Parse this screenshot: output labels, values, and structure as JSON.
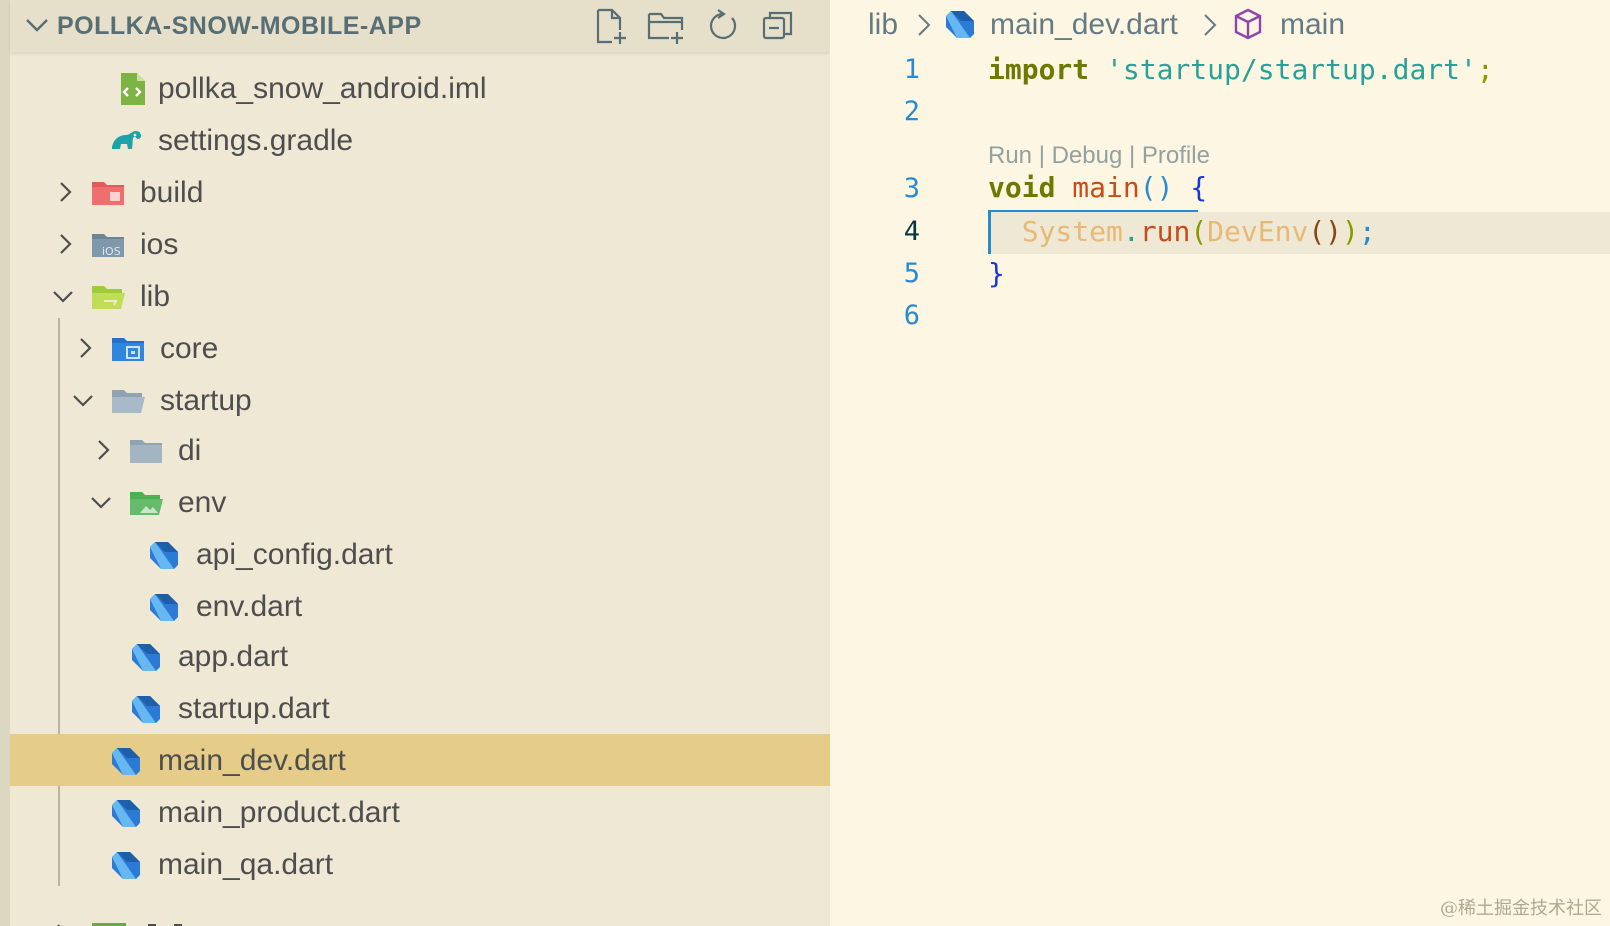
{
  "explorer": {
    "title": "POLLKA-SNOW-MOBILE-APP",
    "actions": [
      "new-file-icon",
      "new-folder-icon",
      "refresh-icon",
      "collapse-all-icon"
    ],
    "items": [
      {
        "label": "pollka_snow_android.iml",
        "icon": "xml-file-icon",
        "kind": "file",
        "depth": 2
      },
      {
        "label": "settings.gradle",
        "icon": "gradle-icon",
        "kind": "file",
        "depth": 2
      },
      {
        "label": "build",
        "icon": "build-folder-icon",
        "kind": "folder",
        "expanded": false,
        "depth": 1
      },
      {
        "label": "ios",
        "icon": "ios-folder-icon",
        "kind": "folder",
        "expanded": false,
        "depth": 1
      },
      {
        "label": "lib",
        "icon": "lib-folder-icon",
        "kind": "folder",
        "expanded": true,
        "depth": 1
      },
      {
        "label": "core",
        "icon": "core-folder-icon",
        "kind": "folder",
        "expanded": false,
        "depth": 2
      },
      {
        "label": "startup",
        "icon": "folder-open-icon",
        "kind": "folder",
        "expanded": true,
        "depth": 2
      },
      {
        "label": "di",
        "icon": "folder-icon",
        "kind": "folder",
        "expanded": false,
        "depth": 3
      },
      {
        "label": "env",
        "icon": "env-folder-icon",
        "kind": "folder",
        "expanded": true,
        "depth": 3
      },
      {
        "label": "api_config.dart",
        "icon": "dart-icon",
        "kind": "file",
        "depth": 4
      },
      {
        "label": "env.dart",
        "icon": "dart-icon",
        "kind": "file",
        "depth": 4
      },
      {
        "label": "app.dart",
        "icon": "dart-icon",
        "kind": "file",
        "depth": 3
      },
      {
        "label": "startup.dart",
        "icon": "dart-icon",
        "kind": "file",
        "depth": 3
      },
      {
        "label": "main_dev.dart",
        "icon": "dart-icon",
        "kind": "file",
        "depth": 2,
        "selected": true
      },
      {
        "label": "main_product.dart",
        "icon": "dart-icon",
        "kind": "file",
        "depth": 2
      },
      {
        "label": "main_qa.dart",
        "icon": "dart-icon",
        "kind": "file",
        "depth": 2
      }
    ]
  },
  "breadcrumb": {
    "folder": "lib",
    "file": "main_dev.dart",
    "symbol": "main"
  },
  "editor": {
    "line_numbers": [
      "1",
      "2",
      "3",
      "4",
      "5",
      "6"
    ],
    "active_line": "4",
    "codelens": "Run | Debug | Profile",
    "code": {
      "l1_kw": "import",
      "l1_str": "'startup/startup.dart'",
      "l1_semi": ";",
      "l3_kw": "void",
      "l3_fn": "main",
      "l3_parens": "()",
      "l3_brace": "{",
      "l4_obj": "System",
      "l4_dot": ".",
      "l4_fn": "run",
      "l4_open": "(",
      "l4_cls": "DevEnv",
      "l4_call": "()",
      "l4_close": ")",
      "l4_semi": ";",
      "l5_brace": "}"
    }
  },
  "watermark": "@稀土掘金技术社区",
  "colors": {
    "sidebar_bg": "#eee8d5",
    "editor_bg": "#fdf6e3",
    "selection": "#e5cc89",
    "dart_blue": "#2b7bd6",
    "keyword": "#6b7a00",
    "string": "#2aa198"
  }
}
